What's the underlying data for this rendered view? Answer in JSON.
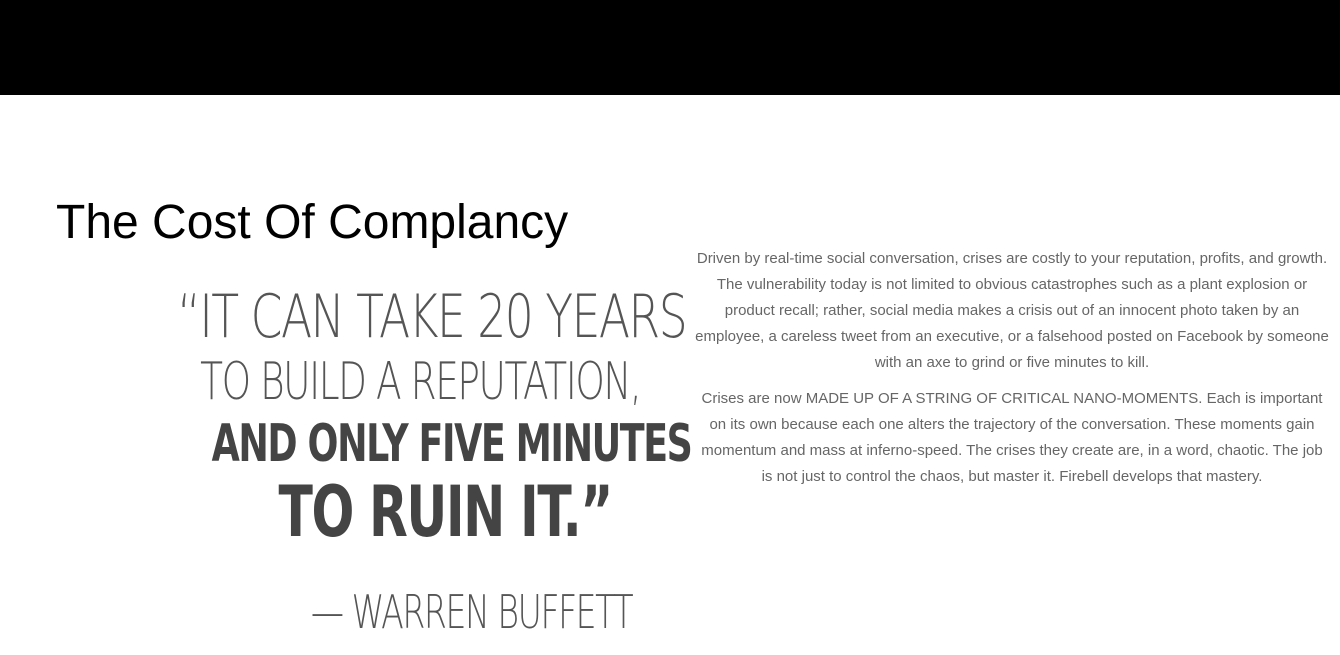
{
  "header": {
    "bar_color": "#000000"
  },
  "section": {
    "title": "The Cost Of Complancy",
    "quote": {
      "line1": "“IT CAN TAKE 20 YEARS",
      "line2": "TO BUILD A REPUTATION,",
      "line3": "AND ONLY FIVE MINUTES",
      "line4": "TO RUIN IT.”",
      "attribution": "— WARREN BUFFETT"
    },
    "paragraphs": [
      "Driven by real-time social conversation, crises are costly to your reputation, profits, and growth. The vulnerability today is not limited to obvious catastrophes such as a plant explosion or product recall; rather, social media makes a crisis out of an innocent photo taken by an employee, a careless tweet from an executive, or a falsehood posted on Facebook by someone with an axe to grind or five minutes to kill.",
      "Crises are now MADE UP OF A STRING OF CRITICAL NANO-MOMENTS. Each is important on its own because each one alters the trajectory of the conversation. These moments gain momentum and mass at inferno-speed. The crises they create are, in a word, chaotic. The job is not just to control the chaos, but master it. Firebell develops that mastery."
    ]
  }
}
